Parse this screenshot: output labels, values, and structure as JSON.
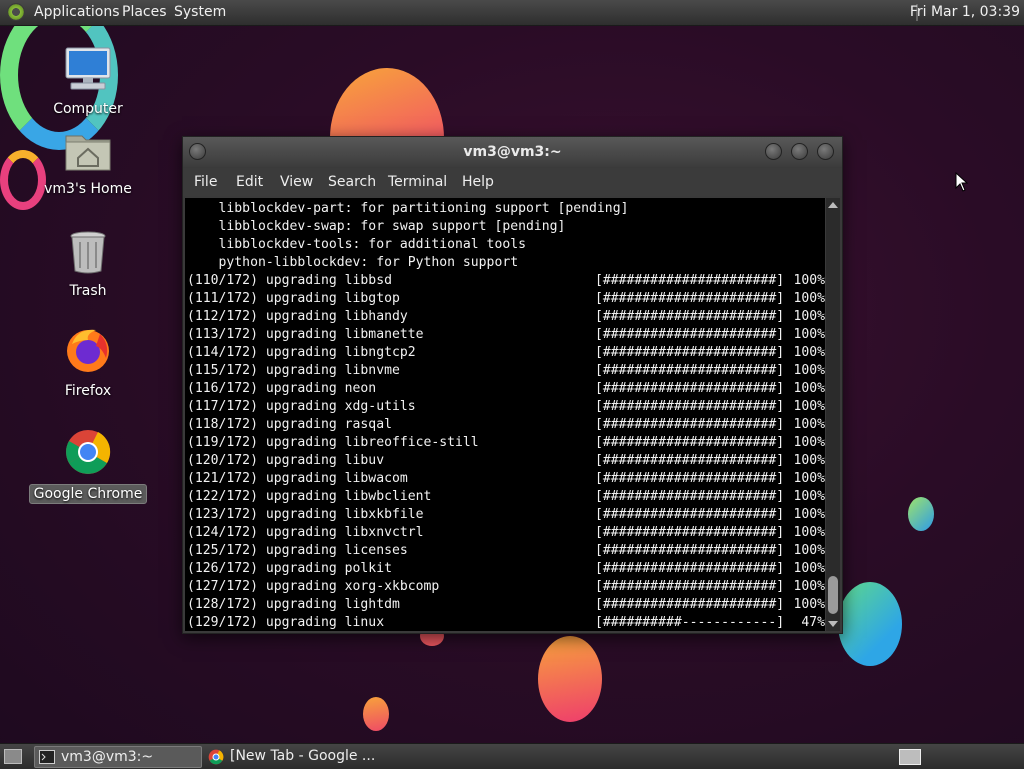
{
  "top_panel": {
    "menus": [
      "Applications",
      "Places",
      "System"
    ],
    "clock": "Fri Mar 1, 03:39"
  },
  "desktop_icons": [
    {
      "label": "Computer",
      "icon": "computer-icon"
    },
    {
      "label": "vm3's Home",
      "icon": "home-folder-icon"
    },
    {
      "label": "Trash",
      "icon": "trash-icon"
    },
    {
      "label": "Firefox",
      "icon": "firefox-icon"
    },
    {
      "label": "Google Chrome",
      "icon": "chrome-icon",
      "selected": true
    }
  ],
  "terminal": {
    "title": "vm3@vm3:~",
    "menu": [
      "File",
      "Edit",
      "View",
      "Search",
      "Terminal",
      "Help"
    ],
    "lines": [
      {
        "text": "    libblockdev-part: for partitioning support [pending]"
      },
      {
        "text": "    libblockdev-swap: for swap support [pending]"
      },
      {
        "text": "    libblockdev-tools: for additional tools"
      },
      {
        "text": "    python-libblockdev: for Python support"
      },
      {
        "text": "(110/172) upgrading libbsd",
        "bar": "[######################]",
        "pct": "100%"
      },
      {
        "text": "(111/172) upgrading libgtop",
        "bar": "[######################]",
        "pct": "100%"
      },
      {
        "text": "(112/172) upgrading libhandy",
        "bar": "[######################]",
        "pct": "100%"
      },
      {
        "text": "(113/172) upgrading libmanette",
        "bar": "[######################]",
        "pct": "100%"
      },
      {
        "text": "(114/172) upgrading libngtcp2",
        "bar": "[######################]",
        "pct": "100%"
      },
      {
        "text": "(115/172) upgrading libnvme",
        "bar": "[######################]",
        "pct": "100%"
      },
      {
        "text": "(116/172) upgrading neon",
        "bar": "[######################]",
        "pct": "100%"
      },
      {
        "text": "(117/172) upgrading xdg-utils",
        "bar": "[######################]",
        "pct": "100%"
      },
      {
        "text": "(118/172) upgrading rasqal",
        "bar": "[######################]",
        "pct": "100%"
      },
      {
        "text": "(119/172) upgrading libreoffice-still",
        "bar": "[######################]",
        "pct": "100%"
      },
      {
        "text": "(120/172) upgrading libuv",
        "bar": "[######################]",
        "pct": "100%"
      },
      {
        "text": "(121/172) upgrading libwacom",
        "bar": "[######################]",
        "pct": "100%"
      },
      {
        "text": "(122/172) upgrading libwbclient",
        "bar": "[######################]",
        "pct": "100%"
      },
      {
        "text": "(123/172) upgrading libxkbfile",
        "bar": "[######################]",
        "pct": "100%"
      },
      {
        "text": "(124/172) upgrading libxnvctrl",
        "bar": "[######################]",
        "pct": "100%"
      },
      {
        "text": "(125/172) upgrading licenses",
        "bar": "[######################]",
        "pct": "100%"
      },
      {
        "text": "(126/172) upgrading polkit",
        "bar": "[######################]",
        "pct": "100%"
      },
      {
        "text": "(127/172) upgrading xorg-xkbcomp",
        "bar": "[######################]",
        "pct": "100%"
      },
      {
        "text": "(128/172) upgrading lightdm",
        "bar": "[######################]",
        "pct": "100%"
      },
      {
        "text": "(129/172) upgrading linux",
        "bar": "[##########------------]",
        "pct": "47%"
      }
    ]
  },
  "taskbar": {
    "tasks": [
      {
        "label": "vm3@vm3:~",
        "icon": "terminal-icon",
        "active": true
      },
      {
        "label": "[New Tab - Google ...",
        "icon": "chrome-icon",
        "active": false
      }
    ]
  }
}
